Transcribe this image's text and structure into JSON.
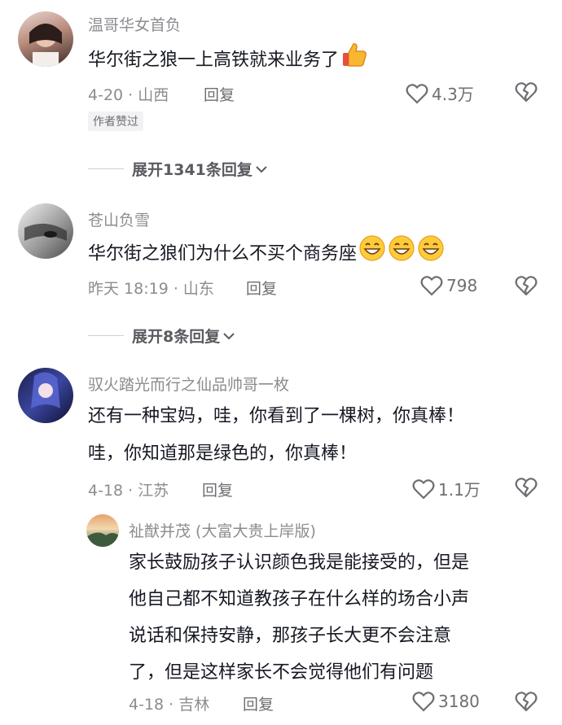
{
  "comments": [
    {
      "username": "温哥华女首负",
      "text_lines": [
        "华尔街之狼一上高铁就来业务了"
      ],
      "emoji": "thumbs-up",
      "meta": "4-20 · 山西",
      "reply_label": "回复",
      "likes": "4.3万",
      "badge": "作者赞过",
      "expand_label": "展开1341条回复"
    },
    {
      "username": "苍山负雪",
      "text_lines": [
        "华尔街之狼们为什么不买个商务座"
      ],
      "emoji": "grin x3",
      "meta": "昨天 18:19 · 山东",
      "reply_label": "回复",
      "likes": "798",
      "expand_label": "展开8条回复"
    },
    {
      "username": "驭火踏光而行之仙品帅哥一枚",
      "text_lines": [
        "还有一种宝妈，哇，你看到了一棵树，你真棒！",
        "哇，你知道那是绿色的，你真棒！"
      ],
      "meta": "4-18 · 江苏",
      "reply_label": "回复",
      "likes": "1.1万"
    }
  ],
  "reply": {
    "username": "祉猷并茂 (大富大贵上岸版)",
    "text_lines": [
      "家长鼓励孩子认识颜色我是能接受的，但是",
      "他自己都不知道教孩子在什么样的场合小声",
      "说话和保持安静，那孩子长大更不会注意",
      "了，但是这样家长不会觉得他们有问题"
    ],
    "meta": "4-18 · 吉林",
    "reply_label": "回复",
    "likes": "3180"
  },
  "icons": [
    "heart-outline-icon",
    "broken-heart-icon",
    "chevron-down-icon",
    "thumbs-up-emoji",
    "grin-emoji"
  ],
  "colors": {
    "text": "#161823",
    "muted": "#8c8c91",
    "badge_bg": "#f2f2f4"
  }
}
